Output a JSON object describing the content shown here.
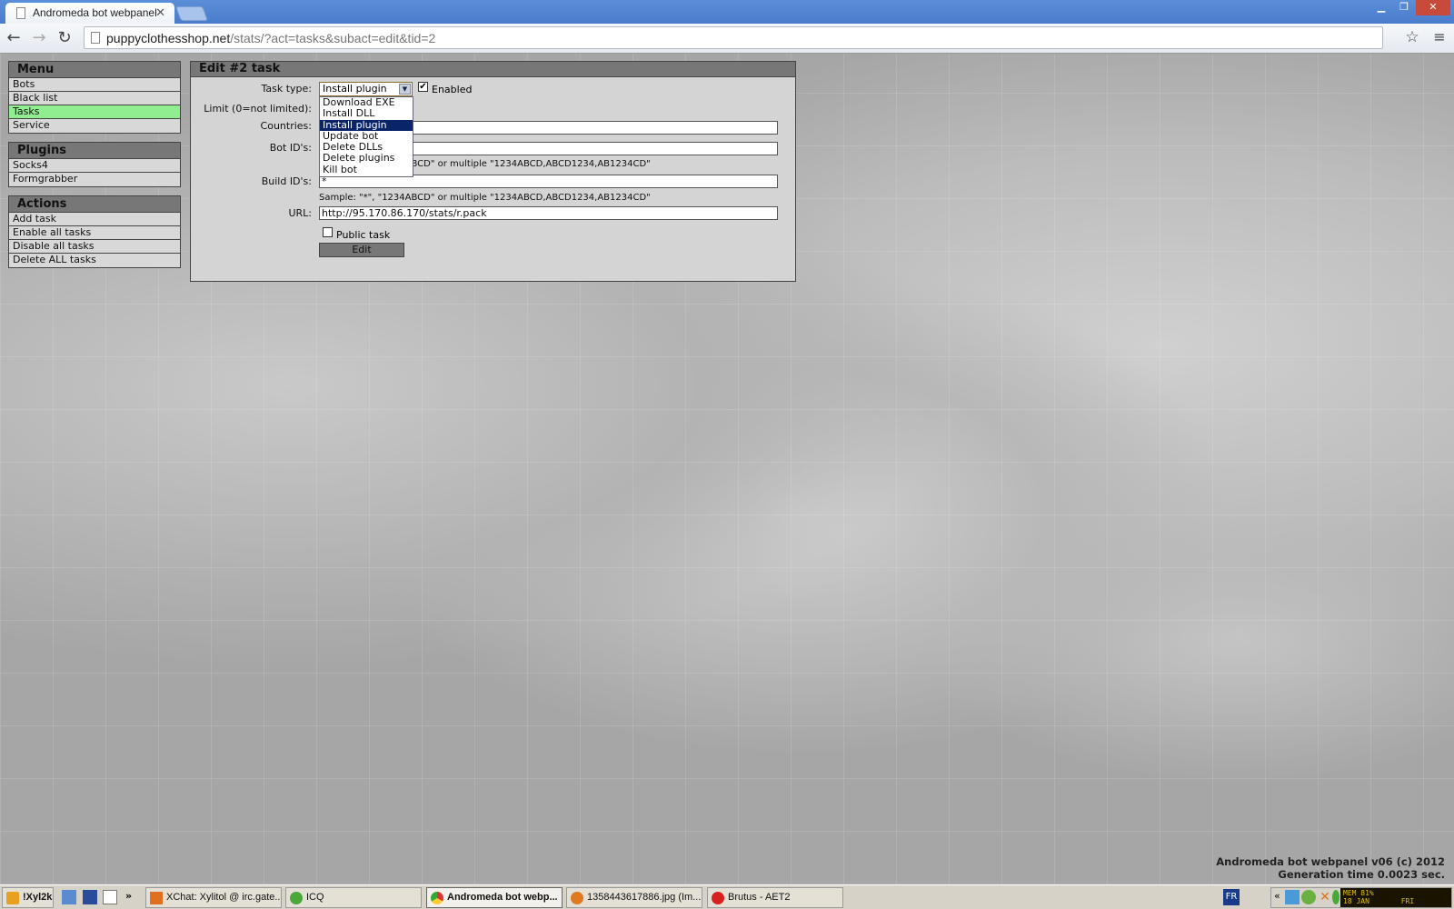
{
  "browser": {
    "tab_title": "Andromeda bot webpanel",
    "url_host": "puppyclothesshop.net",
    "url_path": "/stats/?act=tasks&subact=edit&tid=2"
  },
  "menu": {
    "title": "Menu",
    "items": [
      {
        "label": "Bots"
      },
      {
        "label": "Black list"
      },
      {
        "label": "Tasks",
        "active": true
      },
      {
        "label": "Service"
      }
    ]
  },
  "plugins": {
    "title": "Plugins",
    "items": [
      {
        "label": "Socks4"
      },
      {
        "label": "Formgrabber"
      }
    ]
  },
  "actions": {
    "title": "Actions",
    "items": [
      {
        "label": "Add task"
      },
      {
        "label": "Enable all tasks"
      },
      {
        "label": "Disable all tasks"
      },
      {
        "label": "Delete ALL tasks"
      }
    ]
  },
  "form": {
    "title": "Edit #2 task",
    "task_type_label": "Task type:",
    "task_type_value": "Install plugin",
    "task_type_options": [
      "Download EXE",
      "Install DLL",
      "Install plugin",
      "Update bot",
      "Delete DLLs",
      "Delete plugins",
      "Kill bot"
    ],
    "enabled_label": "Enabled",
    "enabled": true,
    "limit_label": "Limit (0=not limited):",
    "countries_label": "Countries:",
    "countries_value": "",
    "bot_ids_label": "Bot ID's:",
    "bot_ids_value": "",
    "bot_ids_hint": "Sample: \"*\", \"1234ABCD\" or multiple \"1234ABCD,ABCD1234,AB1234CD\"",
    "build_ids_label": "Build ID's:",
    "build_ids_value": "*",
    "build_ids_hint": "Sample: \"*\", \"1234ABCD\" or multiple \"1234ABCD,ABCD1234,AB1234CD\"",
    "url_label": "URL:",
    "url_value": "http://95.170.86.170/stats/r.pack",
    "public_label": "Public task",
    "public": false,
    "submit_label": "Edit"
  },
  "footer": {
    "line1": "Andromeda bot webpanel v06 (c) 2012",
    "line2": "Generation time 0.0023 sec."
  },
  "taskbar": {
    "start": "!Xyl2k",
    "items": [
      {
        "label": "XChat: Xylitol @ irc.gate..."
      },
      {
        "label": "ICQ"
      },
      {
        "label": "Andromeda bot webp...",
        "active": true
      },
      {
        "label": "1358443617886.jpg (Im..."
      },
      {
        "label": "Brutus - AET2"
      }
    ],
    "language": "FR",
    "tray_mem": "MEM 81%",
    "tray_date": "18 JAN",
    "tray_day": "FRI",
    "chevron": "«",
    "quick_more": "»"
  },
  "colors": {
    "active_menu": "#90ee90",
    "selected_option": "#0a246a"
  }
}
